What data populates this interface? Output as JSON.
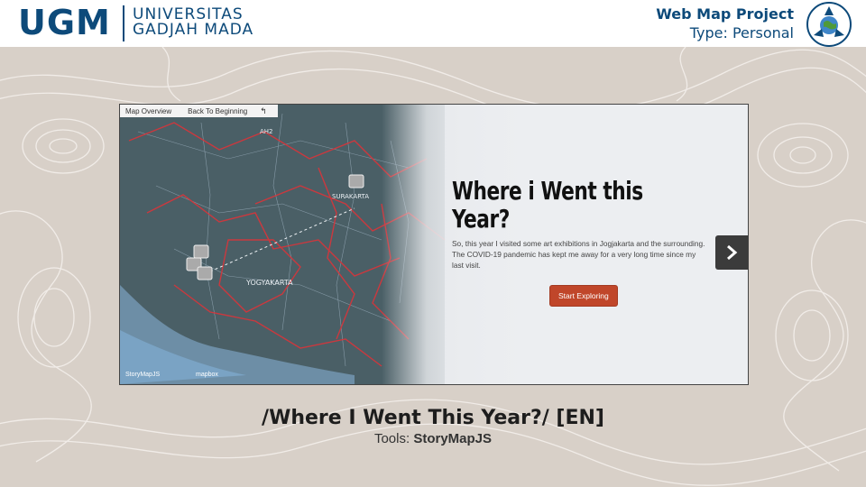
{
  "header": {
    "logo_text": "UGM",
    "university_line1": "UNIVERSITAS",
    "university_line2": "GADJAH MADA",
    "project_title": "Web Map Project",
    "project_type": "Type: Personal"
  },
  "map_embed": {
    "nav": {
      "overview": "Map Overview",
      "back": "Back To Beginning"
    },
    "slide": {
      "title": "Where i Went this Year?",
      "description": "So, this year I visited some art exhibitions in Jogjakarta and the surrounding. The COVID-19 pandemic has kept me away for a very long time since my last visit.",
      "button": "Start Exploring"
    },
    "credits": {
      "storymap": "StoryMapJS",
      "mapbox": "mapbox"
    },
    "map_labels": {
      "city1": "YOGYAKARTA",
      "city2": "SURAKARTA",
      "road": "AH2"
    }
  },
  "caption": {
    "title": "/Where I Went This Year?/ [EN]",
    "tools_label": "Tools:",
    "tools_value": "StoryMapJS"
  },
  "colors": {
    "brand": "#0d4a7a",
    "accent": "#c0462a",
    "background": "#d8d0c8"
  }
}
